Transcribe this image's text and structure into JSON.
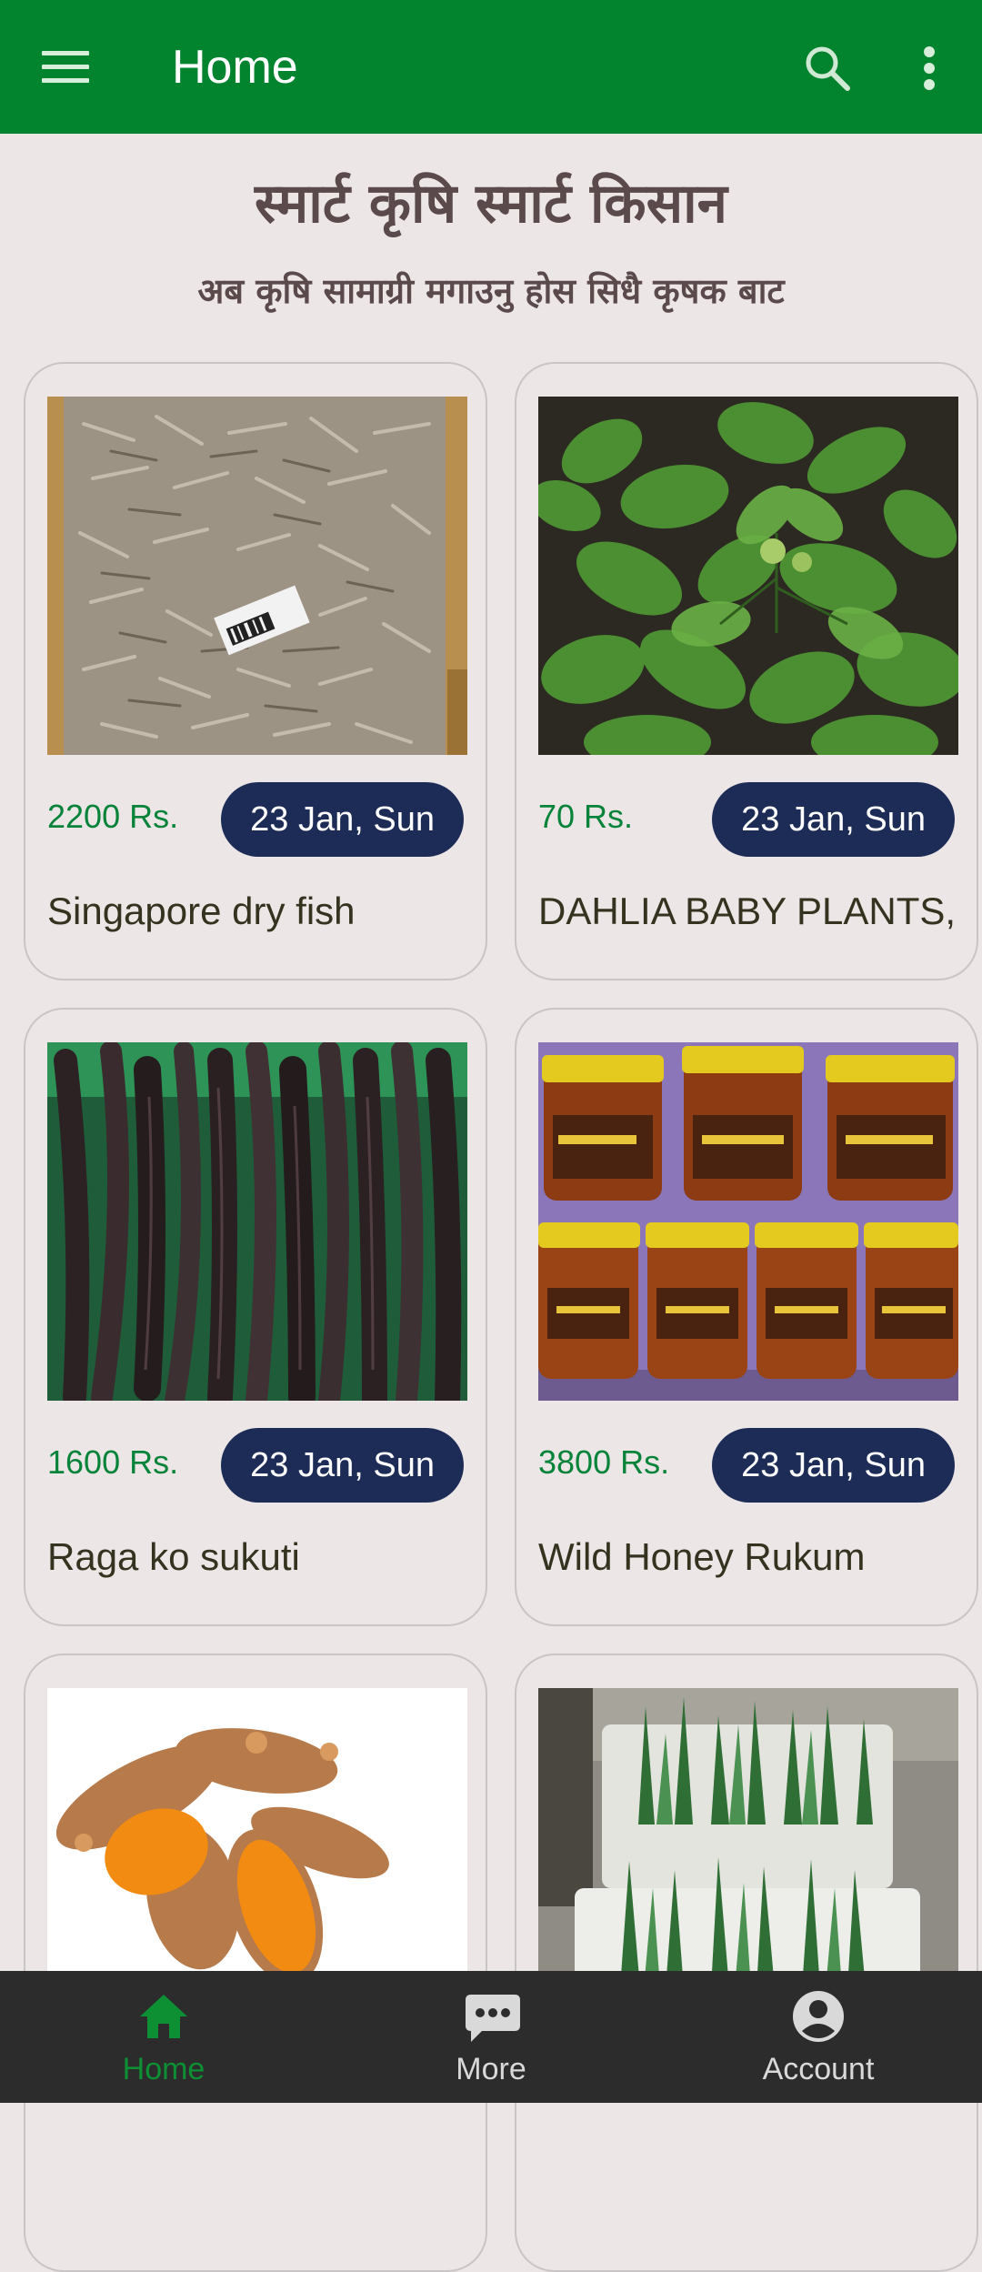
{
  "appbar": {
    "title": "Home",
    "menu_icon": "hamburger-menu-icon",
    "search_icon": "search-icon",
    "more_icon": "more-vert-icon"
  },
  "heading": "स्मार्ट कृषि स्मार्ट किसान",
  "subheading": "अब कृषि सामाग्री मगाउनु होस सिधै कृषक बाट",
  "products": [
    {
      "price": "2200 Rs.",
      "date": "23 Jan, Sun",
      "name": "Singapore dry fish"
    },
    {
      "price": "70 Rs.",
      "date": "23 Jan, Sun",
      "name": "DAHLIA BABY PLANTS,"
    },
    {
      "price": "1600 Rs.",
      "date": "23 Jan, Sun",
      "name": "Raga ko sukuti"
    },
    {
      "price": "3800 Rs.",
      "date": "23 Jan, Sun",
      "name": "Wild Honey Rukum"
    },
    {
      "price": "",
      "date": "",
      "name": ""
    },
    {
      "price": "",
      "date": "",
      "name": ""
    }
  ],
  "bottom_nav": [
    {
      "label": "Home",
      "icon": "home-icon",
      "active": true
    },
    {
      "label": "More",
      "icon": "chat-bubble-icon",
      "active": false
    },
    {
      "label": "Account",
      "icon": "account-circle-icon",
      "active": false
    }
  ],
  "colors": {
    "appbar": "#02832e",
    "background": "#ede6e7",
    "price": "#07843a",
    "date_pill": "#1c2c56",
    "heading": "#5a4a4c",
    "bottom_nav": "#2c2c2c",
    "nav_active": "#0d8f33"
  }
}
